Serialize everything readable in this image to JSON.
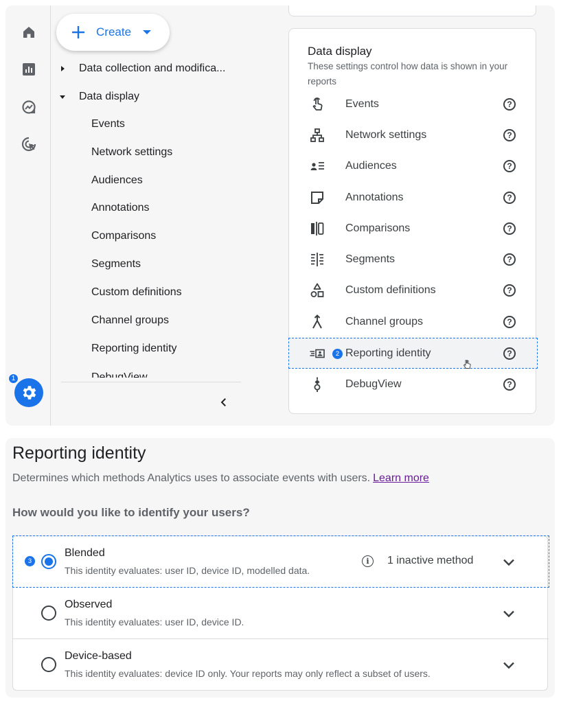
{
  "create_button": {
    "label": "Create",
    "icon": "plus-icon"
  },
  "rail": {
    "items": [
      {
        "name": "home",
        "icon": "home-icon"
      },
      {
        "name": "reports",
        "icon": "bar-chart-icon"
      },
      {
        "name": "explore",
        "icon": "explore-icon"
      },
      {
        "name": "advertising",
        "icon": "cursor-click-icon"
      }
    ],
    "admin_badge": "1"
  },
  "nav": {
    "sections": [
      {
        "label": "Data collection and modifica...",
        "expanded": false
      },
      {
        "label": "Data display",
        "expanded": true
      }
    ],
    "sub_items": [
      "Events",
      "Network settings",
      "Audiences",
      "Annotations",
      "Comparisons",
      "Segments",
      "Custom definitions",
      "Channel groups",
      "Reporting identity"
    ],
    "cut_item": "DebugView"
  },
  "card": {
    "title": "Data display",
    "description": "These settings control how data is shown in your reports",
    "rows": [
      {
        "label": "Events",
        "icon": "touch-icon"
      },
      {
        "label": "Network settings",
        "icon": "network-icon"
      },
      {
        "label": "Audiences",
        "icon": "audience-icon"
      },
      {
        "label": "Annotations",
        "icon": "note-icon"
      },
      {
        "label": "Comparisons",
        "icon": "compare-icon"
      },
      {
        "label": "Segments",
        "icon": "segment-icon"
      },
      {
        "label": "Custom definitions",
        "icon": "shapes-icon"
      },
      {
        "label": "Channel groups",
        "icon": "merge-icon"
      },
      {
        "label": "Reporting identity",
        "icon": "identity-icon",
        "selected": true,
        "badge": "2"
      },
      {
        "label": "DebugView",
        "icon": "debug-icon"
      }
    ],
    "help_glyph": "?"
  },
  "reporting_identity": {
    "title": "Reporting identity",
    "description": "Determines which methods Analytics uses to associate events with users.",
    "learn_more": "Learn more",
    "question": "How would you like to identify your users?",
    "options": [
      {
        "name": "Blended",
        "description": "This identity evaluates: user ID, device ID, modelled data.",
        "selected": true,
        "badge": "3",
        "status": "1 inactive method"
      },
      {
        "name": "Observed",
        "description": "This identity evaluates: user ID, device ID.",
        "selected": false
      },
      {
        "name": "Device-based",
        "description": "This identity evaluates: device ID only. Your reports may only reflect a subset of users.",
        "selected": false
      }
    ],
    "info_glyph": "i"
  },
  "colors": {
    "accent": "#1a73e8",
    "panel_bg": "#f6f6f6",
    "link": "#6a1b9a"
  }
}
